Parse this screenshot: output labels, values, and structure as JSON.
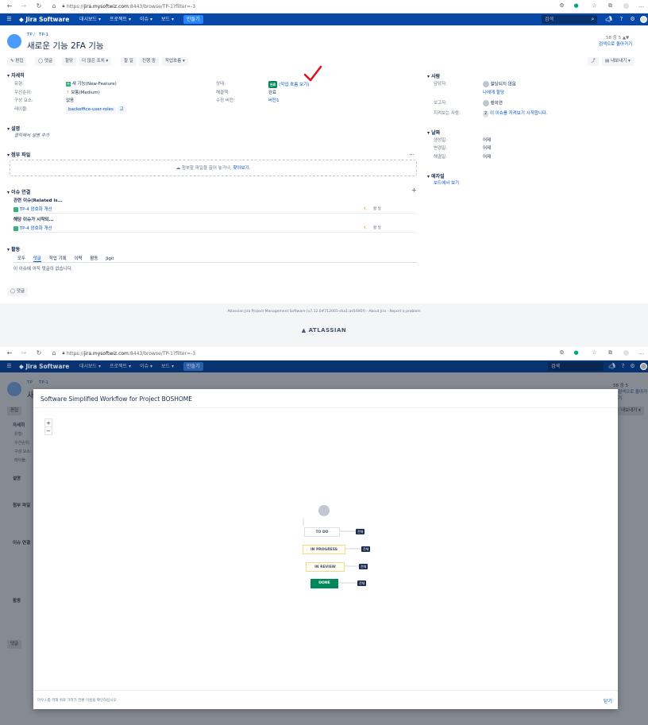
{
  "browser": {
    "url_prefix": "https://",
    "url_host": "jira.mysoftwiz.com",
    "url_path": ":8443/browse/TP-1?filter=-3"
  },
  "jira": {
    "logo_text": "Jira Software",
    "nav": [
      "대시보드 ▾",
      "프로젝트 ▾",
      "이슈 ▾",
      "보드 ▾"
    ],
    "create_label": "만들기",
    "search_placeholder": "검색"
  },
  "issue": {
    "breadcrumb_project": "TP",
    "breadcrumb_key": "TP-1",
    "title": "새로운 기능 2FA 기능",
    "pager": "58 중 5",
    "back_to_search": "검색으로 돌아가기",
    "toolbar": [
      "편집",
      "댓글",
      "할당",
      "더 많은 조치 ▾",
      "할 일",
      "진행 중",
      "작업흐름 ▾"
    ],
    "share_label": "",
    "export_label": "내보내기 ▾",
    "details": {
      "heading": "자세히",
      "type_label": "유형:",
      "type_value": "새 기능(New-Feature)",
      "priority_label": "우선순위:",
      "priority_value": "보통(Medium)",
      "component_label": "구성 요소:",
      "component_value": "없음",
      "labels_label": "레이블:",
      "labels_value": "backoffice-user-roles",
      "labels_extra": "고",
      "status_label": "상태:",
      "status_badge": "완료",
      "status_link": "(작업 흐름 보기)",
      "resolution_label": "해결책:",
      "resolution_value": "완료",
      "fixversion_label": "수정 버전:",
      "fixversion_value": "버전1"
    },
    "description": {
      "heading": "설명",
      "placeholder": "클릭해서 설명 추가"
    },
    "attachments": {
      "heading": "첨부 파일",
      "drop_text": "첨부할 파일을 끌어 놓거나,",
      "browse_link": "찾아보기."
    },
    "links": {
      "heading": "이슈 연결",
      "group1": "관련 이슈(Related is...",
      "group1_item": "TP-4 암호화 개선",
      "group1_status": "할 일",
      "group2": "해당 이슈가 시작되...",
      "group2_item": "TP-4 암호화 개선",
      "group2_status": "할 일"
    },
    "activity": {
      "heading": "활동",
      "tabs": [
        "모두",
        "댓글",
        "작업 기록",
        "이력",
        "활동",
        "Jigit"
      ],
      "empty": "이 이슈에 아직 댓글이 없습니다.",
      "comment_button": "댓글"
    },
    "people": {
      "heading": "사람",
      "assignee_label": "담당자:",
      "assignee_value": "할당되지 않음",
      "assign_me": "나에게 할당",
      "reporter_label": "보고자:",
      "reporter_value": "황희연",
      "watchers_label": "지켜보는 사람:",
      "watchers_count": "2",
      "watchers_link": "이 이슈를 지켜보기 시작합니다."
    },
    "dates": {
      "heading": "날짜",
      "created_label": "생성일:",
      "created_value": "어제",
      "updated_label": "변경일:",
      "updated_value": "어제",
      "resolved_label": "해결일:",
      "resolved_value": "어제"
    },
    "agile": {
      "heading": "애자일",
      "board_link": "보드에서 보기"
    },
    "footer": {
      "version_text": "Atlassian Jira Project Management Software (v7.12.0#712001-sha1:ad1695f)",
      "about": "About Jira",
      "report": "Report a problem",
      "atlassian": "ATLASSIAN"
    }
  },
  "modal": {
    "title": "Software Simplified Workflow for Project BOSHOME",
    "zoom_in": "+",
    "zoom_out": "−",
    "states": [
      "TO DO",
      "IN PROGRESS",
      "IN REVIEW",
      "DONE"
    ],
    "all_label": "전체",
    "hint": "마우스를 격해 위로 가져가 전환 이름을 확인하십시오.",
    "close": "닫기"
  },
  "colors": {
    "jira_blue": "#0747a6",
    "done_green": "#00875a",
    "annotation_red": "#e01020"
  }
}
